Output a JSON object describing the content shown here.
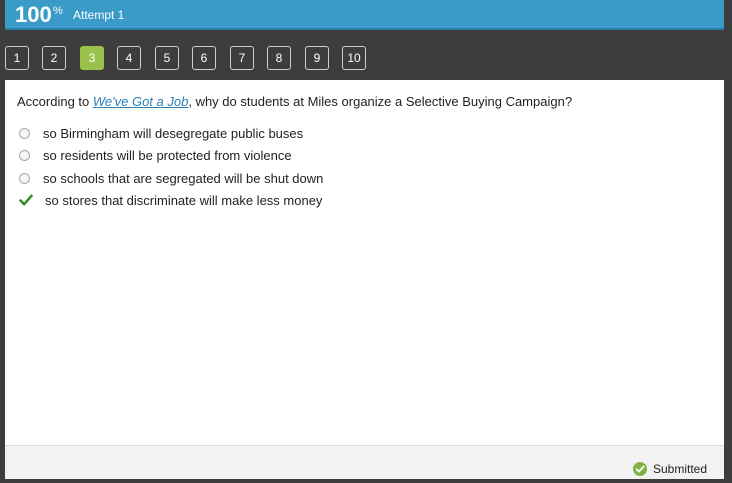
{
  "header": {
    "score": "100",
    "score_unit": "%",
    "attempt": "Attempt 1"
  },
  "question_nav": {
    "items": [
      "1",
      "2",
      "3",
      "4",
      "5",
      "6",
      "7",
      "8",
      "9",
      "10"
    ],
    "active": "3"
  },
  "question": {
    "prefix": "According to ",
    "source_title": "We've Got a Job",
    "suffix": ", why do students at Miles organize a Selective Buying Campaign?"
  },
  "options": [
    {
      "label": "so Birmingham will desegregate public buses",
      "state": "unselected"
    },
    {
      "label": "so residents will be protected from violence",
      "state": "unselected"
    },
    {
      "label": "so schools that are segregated will be shut down",
      "state": "unselected"
    },
    {
      "label": "so stores that discriminate will make less money",
      "state": "correct"
    }
  ],
  "footer": {
    "status": "Submitted"
  },
  "colors": {
    "header_bg": "#3a9bc9",
    "active_question": "#9ac14a",
    "check_green": "#3a8a1e",
    "link": "#2a7fb8"
  }
}
